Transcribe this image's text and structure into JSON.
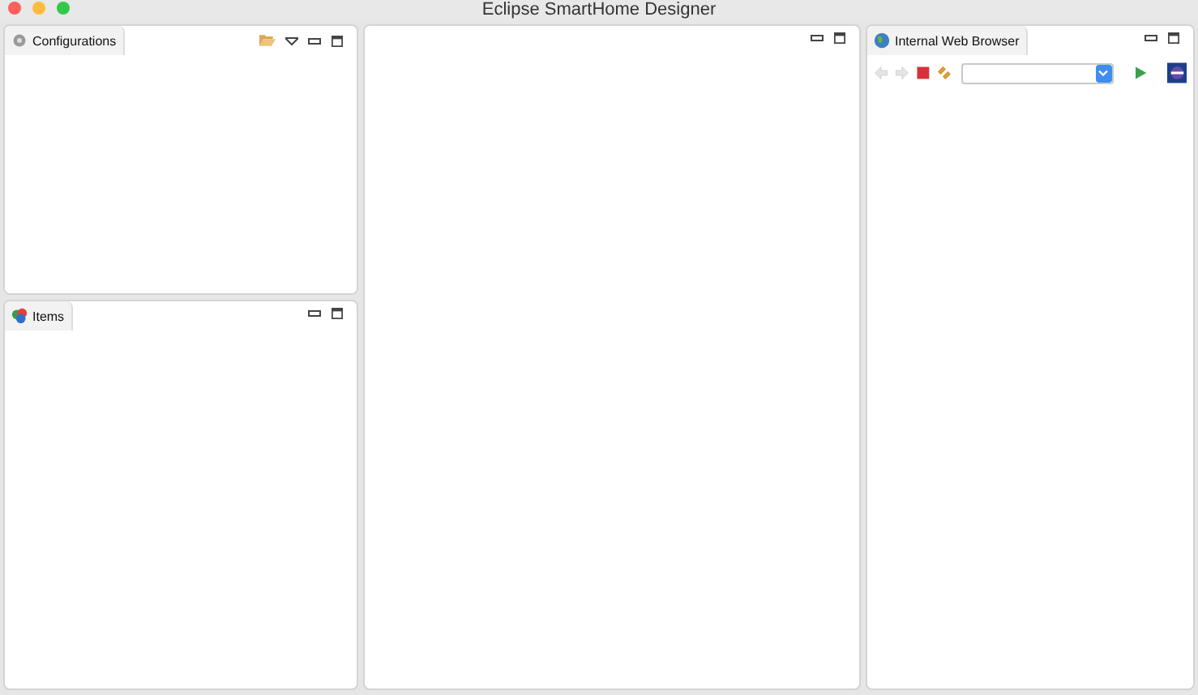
{
  "window": {
    "title": "Eclipse SmartHome Designer"
  },
  "configurations": {
    "title": "Configurations"
  },
  "items": {
    "title": "Items"
  },
  "browser": {
    "title": "Internal Web Browser",
    "nav": [
      {
        "kind": "back",
        "disabled": true
      },
      {
        "kind": "forward",
        "disabled": true
      }
    ]
  }
}
